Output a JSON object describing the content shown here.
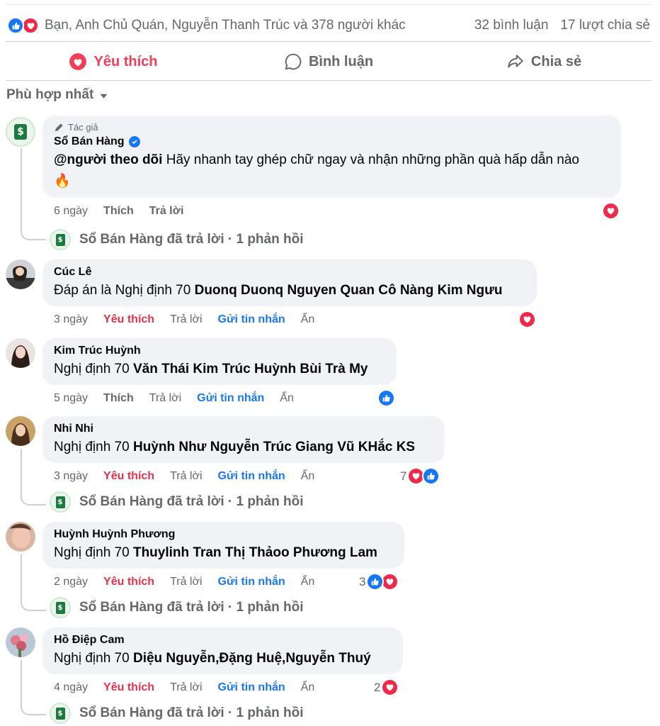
{
  "reactions_summary": {
    "names": "Bạn, Anh Chủ Quán, Nguyễn Thanh Trúc và 378 người khác",
    "comments_count": "32 bình luận",
    "shares_count": "17 lượt chia sẻ"
  },
  "actions": {
    "like_label": "Yêu thích",
    "comment_label": "Bình luận",
    "share_label": "Chia sẻ"
  },
  "sort": {
    "label": "Phù hợp nhất"
  },
  "author_tag": "Tác giả",
  "comments": [
    {
      "name": "Sổ Bán Hàng",
      "text_mention": "@người theo dõi",
      "text_rest": " Hãy nhanh tay ghép chữ ngay và nhận những phần quà hấp dẫn nào",
      "emoji": "🔥",
      "time": "6 ngày",
      "like": "Thích",
      "reply": "Trả lời",
      "reply_summary": "Sổ Bán Hàng đã trả lời · 1 phản hồi"
    },
    {
      "name": "Cúc Lê",
      "text_plain": "Đáp án là Nghị định 70 ",
      "text_bold": "Duonq Duonq Nguyen Quan Cô Nàng Kim Ngưu",
      "time": "3 ngày",
      "like": "Yêu thích",
      "reply": "Trả lời",
      "message": "Gửi tin nhắn",
      "hide": "Ẩn"
    },
    {
      "name": "Kim Trúc Huỳnh",
      "text_plain": "Nghị định 70 ",
      "text_bold": "Văn Thái Kim Trúc Huỳnh Bùi Trà My",
      "time": "5 ngày",
      "like": "Thích",
      "reply": "Trả lời",
      "message": "Gửi tin nhắn",
      "hide": "Ẩn"
    },
    {
      "name": "Nhi Nhi",
      "text_plain": "Nghị định 70 ",
      "text_bold": "Huỳnh Như Nguyễn Trúc Giang Vũ KHắc KS",
      "time": "3 ngày",
      "like": "Yêu thích",
      "reply": "Trả lời",
      "message": "Gửi tin nhắn",
      "hide": "Ẩn",
      "react_count": "7",
      "reply_summary": "Sổ Bán Hàng đã trả lời · 1 phản hồi"
    },
    {
      "name": "Huỳnh Huỳnh Phương",
      "text_plain": "Nghị định 70 ",
      "text_bold": "Thuylinh Tran Thị Thảoo Phương Lam",
      "time": "2 ngày",
      "like": "Yêu thích",
      "reply": "Trả lời",
      "message": "Gửi tin nhắn",
      "hide": "Ẩn",
      "react_count": "3",
      "reply_summary": "Sổ Bán Hàng đã trả lời · 1 phản hồi"
    },
    {
      "name": "Hồ Điệp Cam",
      "text_plain": "Nghị định 70 ",
      "text_bold": "Diệu Nguyễn,Đặng Huệ,Nguyễn Thuý",
      "time": "4 ngày",
      "like": "Yêu thích",
      "reply": "Trả lời",
      "message": "Gửi tin nhắn",
      "hide": "Ẩn",
      "react_count": "2",
      "reply_summary": "Sổ Bán Hàng đã trả lời · 1 phản hồi"
    }
  ],
  "colors": {
    "like_blue": "#1877f2",
    "love_red": "#f33e58",
    "bubble_gray": "#f0f2f5",
    "secondary_text": "#65676b"
  }
}
